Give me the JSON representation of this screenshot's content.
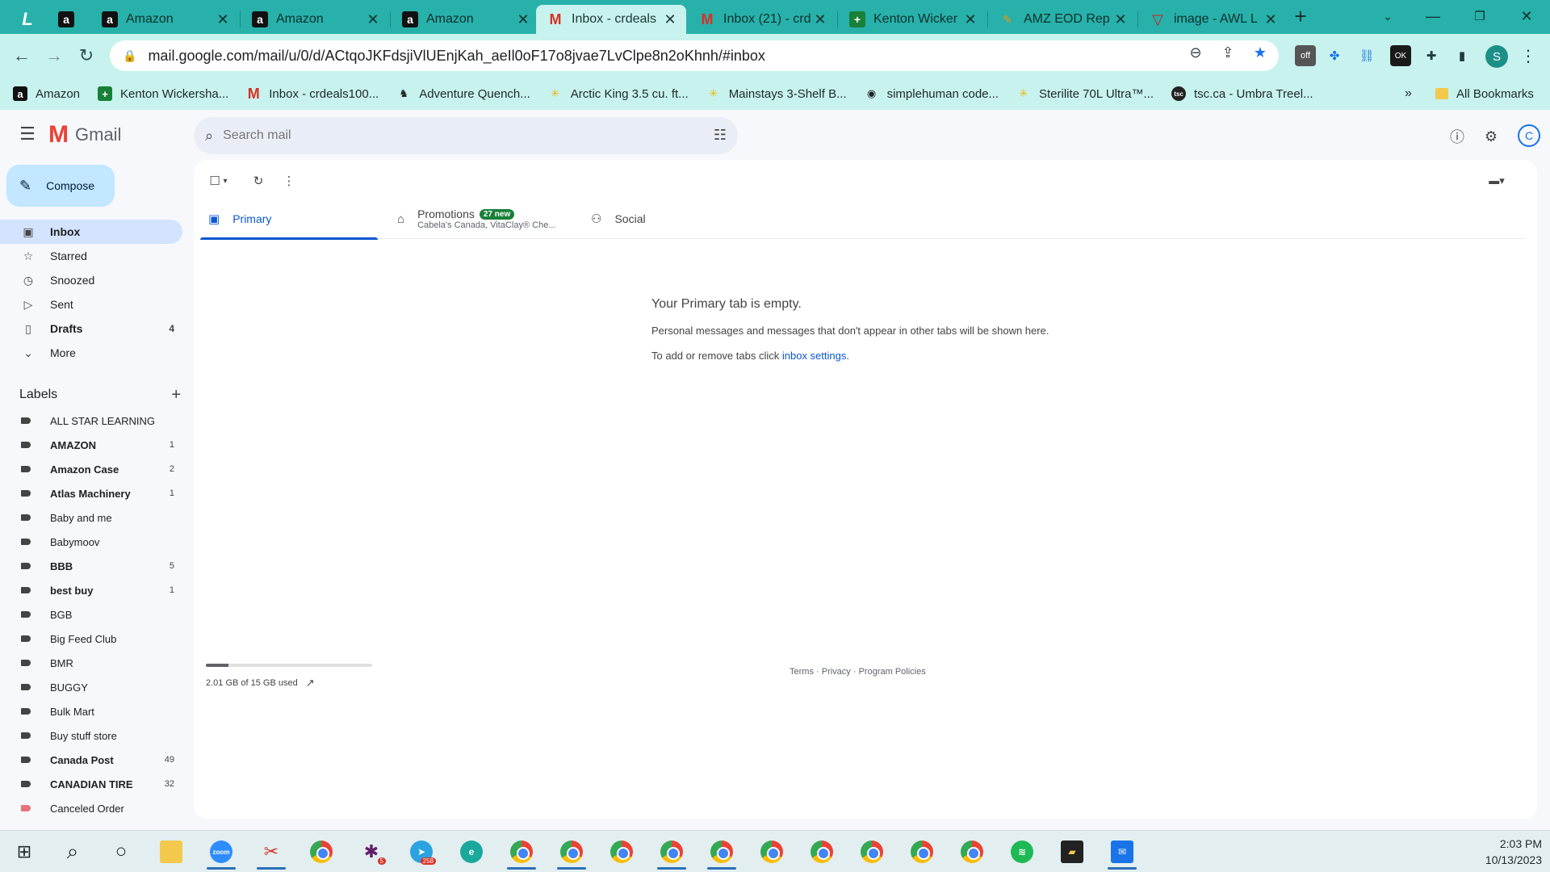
{
  "browser": {
    "tabs": [
      {
        "label": "",
        "icon": "l-icon"
      },
      {
        "label": "",
        "icon": "amazon-icon"
      },
      {
        "label": "Amazon",
        "icon": "amazon-icon"
      },
      {
        "label": "Amazon",
        "icon": "amazon-icon"
      },
      {
        "label": "Amazon",
        "icon": "amazon-icon"
      },
      {
        "label": "Inbox - crdeals",
        "icon": "gmail-icon",
        "active": true
      },
      {
        "label": "Inbox (21) - crd",
        "icon": "gmail-icon"
      },
      {
        "label": "Kenton Wicker",
        "icon": "sheets-icon"
      },
      {
        "label": "AMZ EOD Rep",
        "icon": "pen-icon"
      },
      {
        "label": "image - AWL L",
        "icon": "vivaldi-icon"
      }
    ],
    "url": "mail.google.com/mail/u/0/d/ACtqoJKFdsjiVlUEnjKah_aeIl0oF17o8jvae7LvClpe8n2oKhnh/#inbox",
    "profile_initial": "S",
    "bookmarks": [
      {
        "label": "Amazon",
        "icon": "amazon-icon"
      },
      {
        "label": "Kenton Wickersha...",
        "icon": "sheets-icon"
      },
      {
        "label": "Inbox - crdeals100...",
        "icon": "gmail-icon"
      },
      {
        "label": "Adventure Quench...",
        "icon": "moose-icon"
      },
      {
        "label": "Arctic King 3.5 cu. ft...",
        "icon": "walmart-icon"
      },
      {
        "label": "Mainstays 3-Shelf B...",
        "icon": "walmart-icon"
      },
      {
        "label": "simplehuman code...",
        "icon": "globe-icon"
      },
      {
        "label": "Sterilite 70L Ultra™...",
        "icon": "walmart-icon"
      },
      {
        "label": "tsc.ca - Umbra Treel...",
        "icon": "tsc-icon"
      }
    ],
    "all_bookmarks": "All Bookmarks"
  },
  "gmail": {
    "brand": "Gmail",
    "search_placeholder": "Search mail",
    "compose": "Compose",
    "nav": [
      {
        "label": "Inbox",
        "icon": "inbox-icon",
        "count": "",
        "active": true
      },
      {
        "label": "Starred",
        "icon": "star-icon",
        "count": ""
      },
      {
        "label": "Snoozed",
        "icon": "clock-icon",
        "count": ""
      },
      {
        "label": "Sent",
        "icon": "send-icon",
        "count": ""
      },
      {
        "label": "Drafts",
        "icon": "draft-icon",
        "count": "4",
        "bold": true
      },
      {
        "label": "More",
        "icon": "chevron-down-icon",
        "count": ""
      }
    ],
    "labels_title": "Labels",
    "labels": [
      {
        "name": "ALL STAR LEARNING",
        "count": "",
        "bold": false
      },
      {
        "name": "AMAZON",
        "count": "1",
        "bold": true
      },
      {
        "name": "Amazon Case",
        "count": "2",
        "bold": true
      },
      {
        "name": "Atlas Machinery",
        "count": "1",
        "bold": true
      },
      {
        "name": "Baby and me",
        "count": "",
        "bold": false
      },
      {
        "name": "Babymoov",
        "count": "",
        "bold": false
      },
      {
        "name": "BBB",
        "count": "5",
        "bold": true
      },
      {
        "name": "best buy",
        "count": "1",
        "bold": true
      },
      {
        "name": "BGB",
        "count": "",
        "bold": false
      },
      {
        "name": "Big Feed Club",
        "count": "",
        "bold": false
      },
      {
        "name": "BMR",
        "count": "",
        "bold": false
      },
      {
        "name": "BUGGY",
        "count": "",
        "bold": false
      },
      {
        "name": "Bulk Mart",
        "count": "",
        "bold": false
      },
      {
        "name": "Buy stuff store",
        "count": "",
        "bold": false
      },
      {
        "name": "Canada Post",
        "count": "49",
        "bold": true
      },
      {
        "name": "CANADIAN TIRE",
        "count": "32",
        "bold": true
      },
      {
        "name": "Canceled Order",
        "count": "",
        "bold": false,
        "color": "#e8727a"
      }
    ],
    "tabs": {
      "primary": "Primary",
      "promotions": "Promotions",
      "promotions_badge": "27 new",
      "promotions_sub": "Cabela's Canada, VitaClay® Che...",
      "social": "Social"
    },
    "empty": {
      "title": "Your Primary tab is empty.",
      "desc": "Personal messages and messages that don't appear in other tabs will be shown here.",
      "settings_prefix": "To add or remove tabs click ",
      "settings_link": "inbox settings",
      "settings_suffix": "."
    },
    "storage": {
      "text": "2.01 GB of 15 GB used",
      "used_fraction": 0.134
    },
    "footer": {
      "terms": "Terms",
      "privacy": "Privacy",
      "policies": "Program Policies",
      "sep": " · "
    }
  },
  "taskbar": {
    "time": "2:03 PM",
    "date": "10/13/2023",
    "slack_badge": "5",
    "telegram_badge": "258"
  }
}
